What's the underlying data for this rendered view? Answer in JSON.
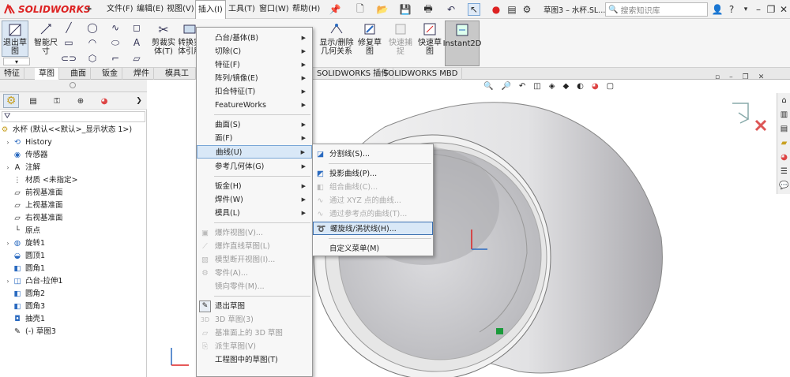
{
  "app": {
    "logo_text": "SOLIDWORKS",
    "doc_title": "草图3 – 水杯.SL...",
    "search_placeholder": "搜索知识库"
  },
  "menubar": [
    {
      "label": "文件(F)"
    },
    {
      "label": "编辑(E)"
    },
    {
      "label": "视图(V)"
    },
    {
      "label": "插入(I)"
    },
    {
      "label": "工具(T)"
    },
    {
      "label": "窗口(W)"
    },
    {
      "label": "帮助(H)"
    }
  ],
  "ribbon": {
    "exit_sketch": "退出草\n图",
    "smart_dim": "智能尺\n寸",
    "trim": "剪裁实\n体(T)",
    "convert": "转换实\n体引用",
    "display_rel": "显示/删除\n几何关系",
    "repair": "修复草\n图",
    "quick_snap": "快速捕\n捉",
    "rapid_sketch": "快速草\n图",
    "instant2d": "Instant2D"
  },
  "tabs": [
    "特征",
    "草图",
    "曲面",
    "钣金",
    "焊件",
    "模具工具",
    "SOLIDWORKS 插件",
    "SOLIDWORKS MBD"
  ],
  "tree": {
    "root": "水杯 (默认<<默认>_显示状态 1>)",
    "items": [
      {
        "label": "History"
      },
      {
        "label": "传感器"
      },
      {
        "label": "注解"
      },
      {
        "label": "材质 <未指定>"
      },
      {
        "label": "前视基准面"
      },
      {
        "label": "上视基准面"
      },
      {
        "label": "右视基准面"
      },
      {
        "label": "原点"
      },
      {
        "label": "旋转1"
      },
      {
        "label": "圆顶1"
      },
      {
        "label": "圆角1"
      },
      {
        "label": "凸台-拉伸1"
      },
      {
        "label": "圆角2"
      },
      {
        "label": "圆角3"
      },
      {
        "label": "抽壳1"
      },
      {
        "label": "(-) 草图3"
      }
    ]
  },
  "insert_menu": {
    "items": [
      {
        "label": "凸台/基体(B)"
      },
      {
        "label": "切除(C)"
      },
      {
        "label": "特征(F)"
      },
      {
        "label": "阵列/镜像(E)"
      },
      {
        "label": "扣合特征(T)"
      },
      {
        "label": "FeatureWorks"
      },
      {
        "label": "曲面(S)"
      },
      {
        "label": "面(F)"
      },
      {
        "label": "曲线(U)"
      },
      {
        "label": "参考几何体(G)"
      },
      {
        "label": "钣金(H)"
      },
      {
        "label": "焊件(W)"
      },
      {
        "label": "模具(L)"
      },
      {
        "label": "爆炸视图(V)..."
      },
      {
        "label": "爆炸直线草图(L)"
      },
      {
        "label": "模型断开视图(I)..."
      },
      {
        "label": "零件(A)..."
      },
      {
        "label": "镜向零件(M)..."
      },
      {
        "label": "退出草图"
      },
      {
        "label": "3D 草图(3)"
      },
      {
        "label": "基准面上的 3D 草图"
      },
      {
        "label": "派生草图(V)"
      },
      {
        "label": "工程图中的草图(T)"
      }
    ]
  },
  "curve_submenu": {
    "items": [
      {
        "label": "分割线(S)..."
      },
      {
        "label": "投影曲线(P)..."
      },
      {
        "label": "组合曲线(C)..."
      },
      {
        "label": "通过 XYZ 点的曲线..."
      },
      {
        "label": "通过参考点的曲线(T)..."
      },
      {
        "label": "螺旋线/涡状线(H)..."
      },
      {
        "label": "自定义菜单(M)"
      }
    ]
  },
  "colors": {
    "accent": "#3a6fb0",
    "highlight": "#d9e8f7",
    "model_shade": "#c9c9cc"
  }
}
